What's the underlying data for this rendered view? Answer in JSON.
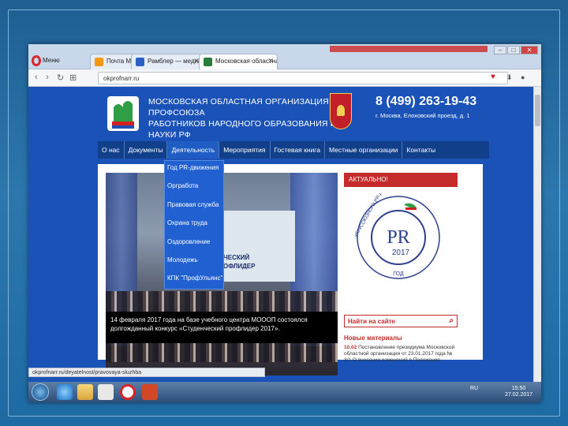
{
  "browser": {
    "menu_label": "Меню",
    "tabs": [
      {
        "label": "Почта Mail.Ru",
        "active": false,
        "favicon_color": "#f59a10"
      },
      {
        "label": "Рамблер — медийный п",
        "active": false,
        "favicon_color": "#2b61c7"
      },
      {
        "label": "Московская областная о",
        "active": true,
        "favicon_color": "#2d7d3a"
      }
    ],
    "url": "okprofnarr.ru"
  },
  "site": {
    "org_title_line1": "МОСКОВСКАЯ ОБЛАСТНАЯ ОРГАНИЗАЦИЯ ПРОФСОЮЗА",
    "org_title_line2": "РАБОТНИКОВ НАРОДНОГО ОБРАЗОВАНИЯ И НАУКИ РФ",
    "phone": "8 (499) 263-19-43",
    "address": "г. Москва, Елоховский проезд, д. 1",
    "menu": [
      {
        "label": "О нас"
      },
      {
        "label": "Документы"
      },
      {
        "label": "Деятельность",
        "active": true
      },
      {
        "label": "Мероприятия"
      },
      {
        "label": "Гостевая книга"
      },
      {
        "label": "Местные организации"
      },
      {
        "label": "Контакты"
      }
    ],
    "dropdown": [
      "Год PR-движения",
      "Оргработа",
      "Правовая служба",
      "Охрана труда",
      "Оздоровление",
      "Молодежь",
      "КПК \"ПрофУльянс\""
    ],
    "photo_screen_text_line1": "ЕНЧЕСКИЙ",
    "photo_screen_text_line2": "ПРОФЛИДЕР",
    "photo_screen_small": "евраля 2017 года\nобластной конкурс",
    "caption": "14 февраля 2017 года на базе учебного центра МОООП состоялся долгожданный конкурс «Студенческий профлидер 2017».",
    "sidebar_title": "АКТУАЛЬНО!",
    "seal": {
      "ring_text": "ПРОФСОЮЗНОГО PR-ДВИЖЕНИЯ",
      "bottom_text": "ГОД",
      "center": "PR",
      "year": "2017"
    },
    "search_label": "Найти на сайте",
    "new_materials": "Новые материалы",
    "news_date": "10.02",
    "news_text": "Постановление президиума Московской областной организации от 23.01.2017 года № 3/1 О внесении изменений в Положение"
  },
  "statusbar": "okprofnarr.ru/deyatelnost/pravovaya-sluzhba",
  "taskbar": {
    "tray_lang": "RU",
    "clock_time": "15:50",
    "clock_date": "27.02.2017"
  },
  "colors": {
    "page_bg": "#1a52b8",
    "menu_bg": "#123f8a",
    "accent_red": "#c62b2b"
  }
}
